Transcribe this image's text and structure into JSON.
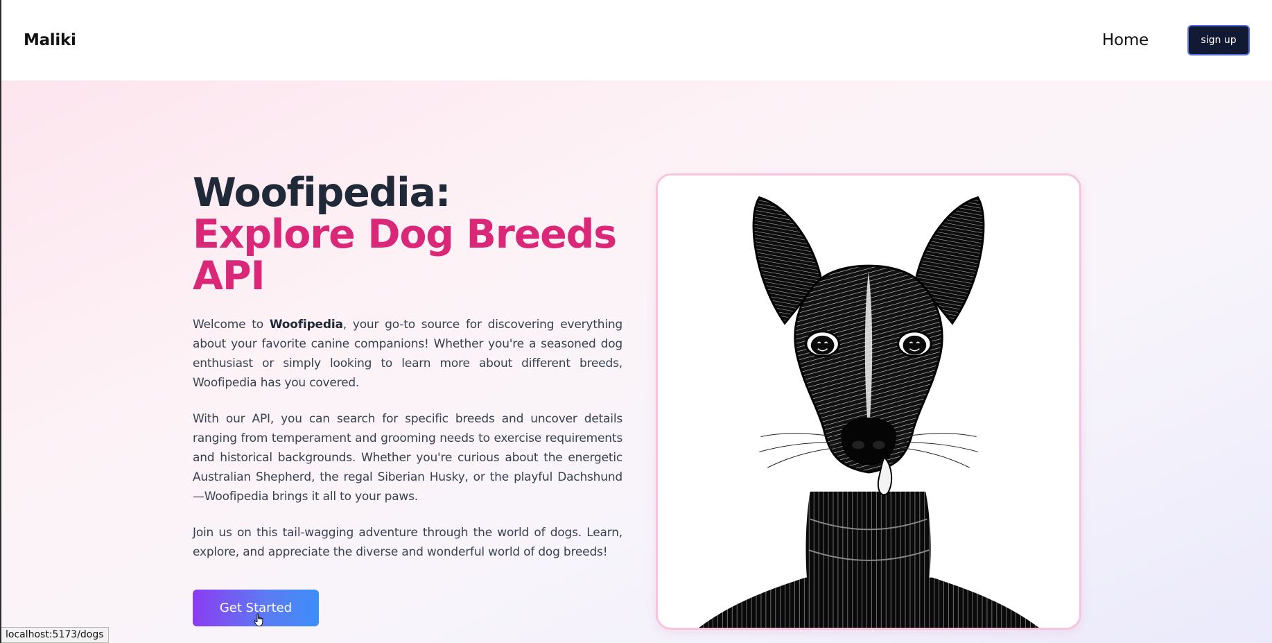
{
  "navbar": {
    "brand": "Maliki",
    "home_link": "Home",
    "signup_label": "sign up"
  },
  "hero": {
    "title_line1": "Woofipedia:",
    "title_line2": "Explore Dog Breeds API",
    "paragraph1": {
      "prefix": "Welcome to ",
      "bold": "Woofipedia",
      "suffix": ", your go-to source for discovering everything about your favorite canine companions! Whether you're a seasoned dog enthusiast or simply looking to learn more about different breeds, Woofipedia has you covered."
    },
    "paragraph2": "With our API, you can search for specific breeds and uncover details ranging from temperament and grooming needs to exercise requirements and historical backgrounds. Whether you're curious about the energetic Australian Shepherd, the regal Siberian Husky, or the playful Dachshund—Woofipedia brings it all to your paws.",
    "paragraph3": "Join us on this tail-wagging adventure through the world of dogs. Learn, explore, and appreciate the diverse and wonderful world of dog breeds!",
    "cta_label": "Get Started"
  },
  "status_bar": {
    "url": "localhost:5173/dogs"
  },
  "icons": {
    "cursor": "hand-pointer-icon"
  },
  "colors": {
    "title_dark": "#1f2937",
    "title_accent": "#db2777",
    "signup_bg": "#121a33",
    "card_border": "#f7c4de"
  }
}
